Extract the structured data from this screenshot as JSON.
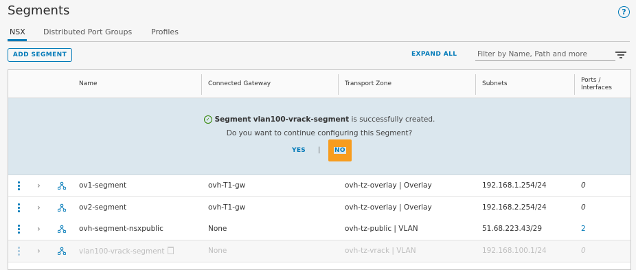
{
  "page": {
    "title": "Segments",
    "help_glyph": "?"
  },
  "tabs": [
    "NSX",
    "Distributed Port Groups",
    "Profiles"
  ],
  "toolbar": {
    "add_label": "ADD SEGMENT",
    "expand_label": "EXPAND ALL",
    "filter_placeholder": "Filter by Name, Path and more"
  },
  "columns": {
    "name": "Name",
    "gateway": "Connected Gateway",
    "zone": "Transport Zone",
    "subnets": "Subnets",
    "ports_line1": "Ports /",
    "ports_line2": "Interfaces"
  },
  "banner": {
    "prefix": "Segment",
    "segment_name": "vlan100-vrack-segment",
    "suffix": "is successfully created.",
    "question": "Do you want to continue configuring this Segment?",
    "yes_label": "YES",
    "separator": "|",
    "no_label": "NO"
  },
  "rows": [
    {
      "name": "ov1-segment",
      "gateway": "ovh-T1-gw",
      "zone": "ovh-tz-overlay | Overlay",
      "subnets": "192.168.1.254/24",
      "ports": "0"
    },
    {
      "name": "ov2-segment",
      "gateway": "ovh-T1-gw",
      "zone": "ovh-tz-overlay | Overlay",
      "subnets": "192.168.2.254/24",
      "ports": "0"
    },
    {
      "name": "ovh-segment-nsxpublic",
      "gateway": "None",
      "zone": "ovh-tz-public | VLAN",
      "subnets": "51.68.223.43/29",
      "ports": "2"
    },
    {
      "name": "vlan100-vrack-segment",
      "gateway": "None",
      "zone": "ovh-tz-vrack | VLAN",
      "subnets": "192.168.100.1/24",
      "ports": "0"
    }
  ],
  "colors": {
    "accent": "#0079b8",
    "highlight": "#f79c1e",
    "banner_bg": "#dbe7ee",
    "success": "#2f8400"
  },
  "icons": [
    "help-icon",
    "filter-icon",
    "kebab-menu-icon",
    "chevron-right-icon",
    "segment-icon",
    "success-check-icon",
    "trash-icon"
  ]
}
